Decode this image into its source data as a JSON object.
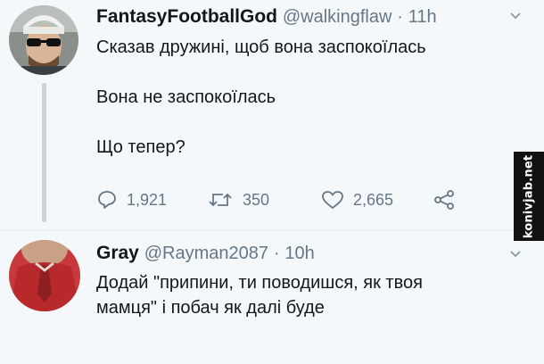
{
  "tweets": [
    {
      "display_name": "FantasyFootballGod",
      "handle": "@walkingflaw",
      "separator": "·",
      "time": "11h",
      "lines": [
        "Сказав дружині, щоб вона заспокоїлась",
        "Вона не заспокоїлась",
        "Що тепер?"
      ],
      "actions": {
        "replies": "1,921",
        "retweets": "350",
        "likes": "2,665"
      }
    },
    {
      "display_name": "Gray",
      "handle": "@Rayman2087",
      "separator": "·",
      "time": "10h",
      "lines": [
        "Додай \"припини, ти поводишся, як твоя",
        "мамця\" і побач як далі буде"
      ]
    }
  ],
  "watermark": "konivjab.net",
  "icons": {
    "reply": "reply-icon",
    "retweet": "retweet-icon",
    "like": "heart-icon",
    "share": "share-icon",
    "menu": "chevron-down-icon"
  },
  "colors": {
    "background": "#f5f8fa",
    "muted_text": "#657786",
    "thread_line": "#c8d3db"
  }
}
